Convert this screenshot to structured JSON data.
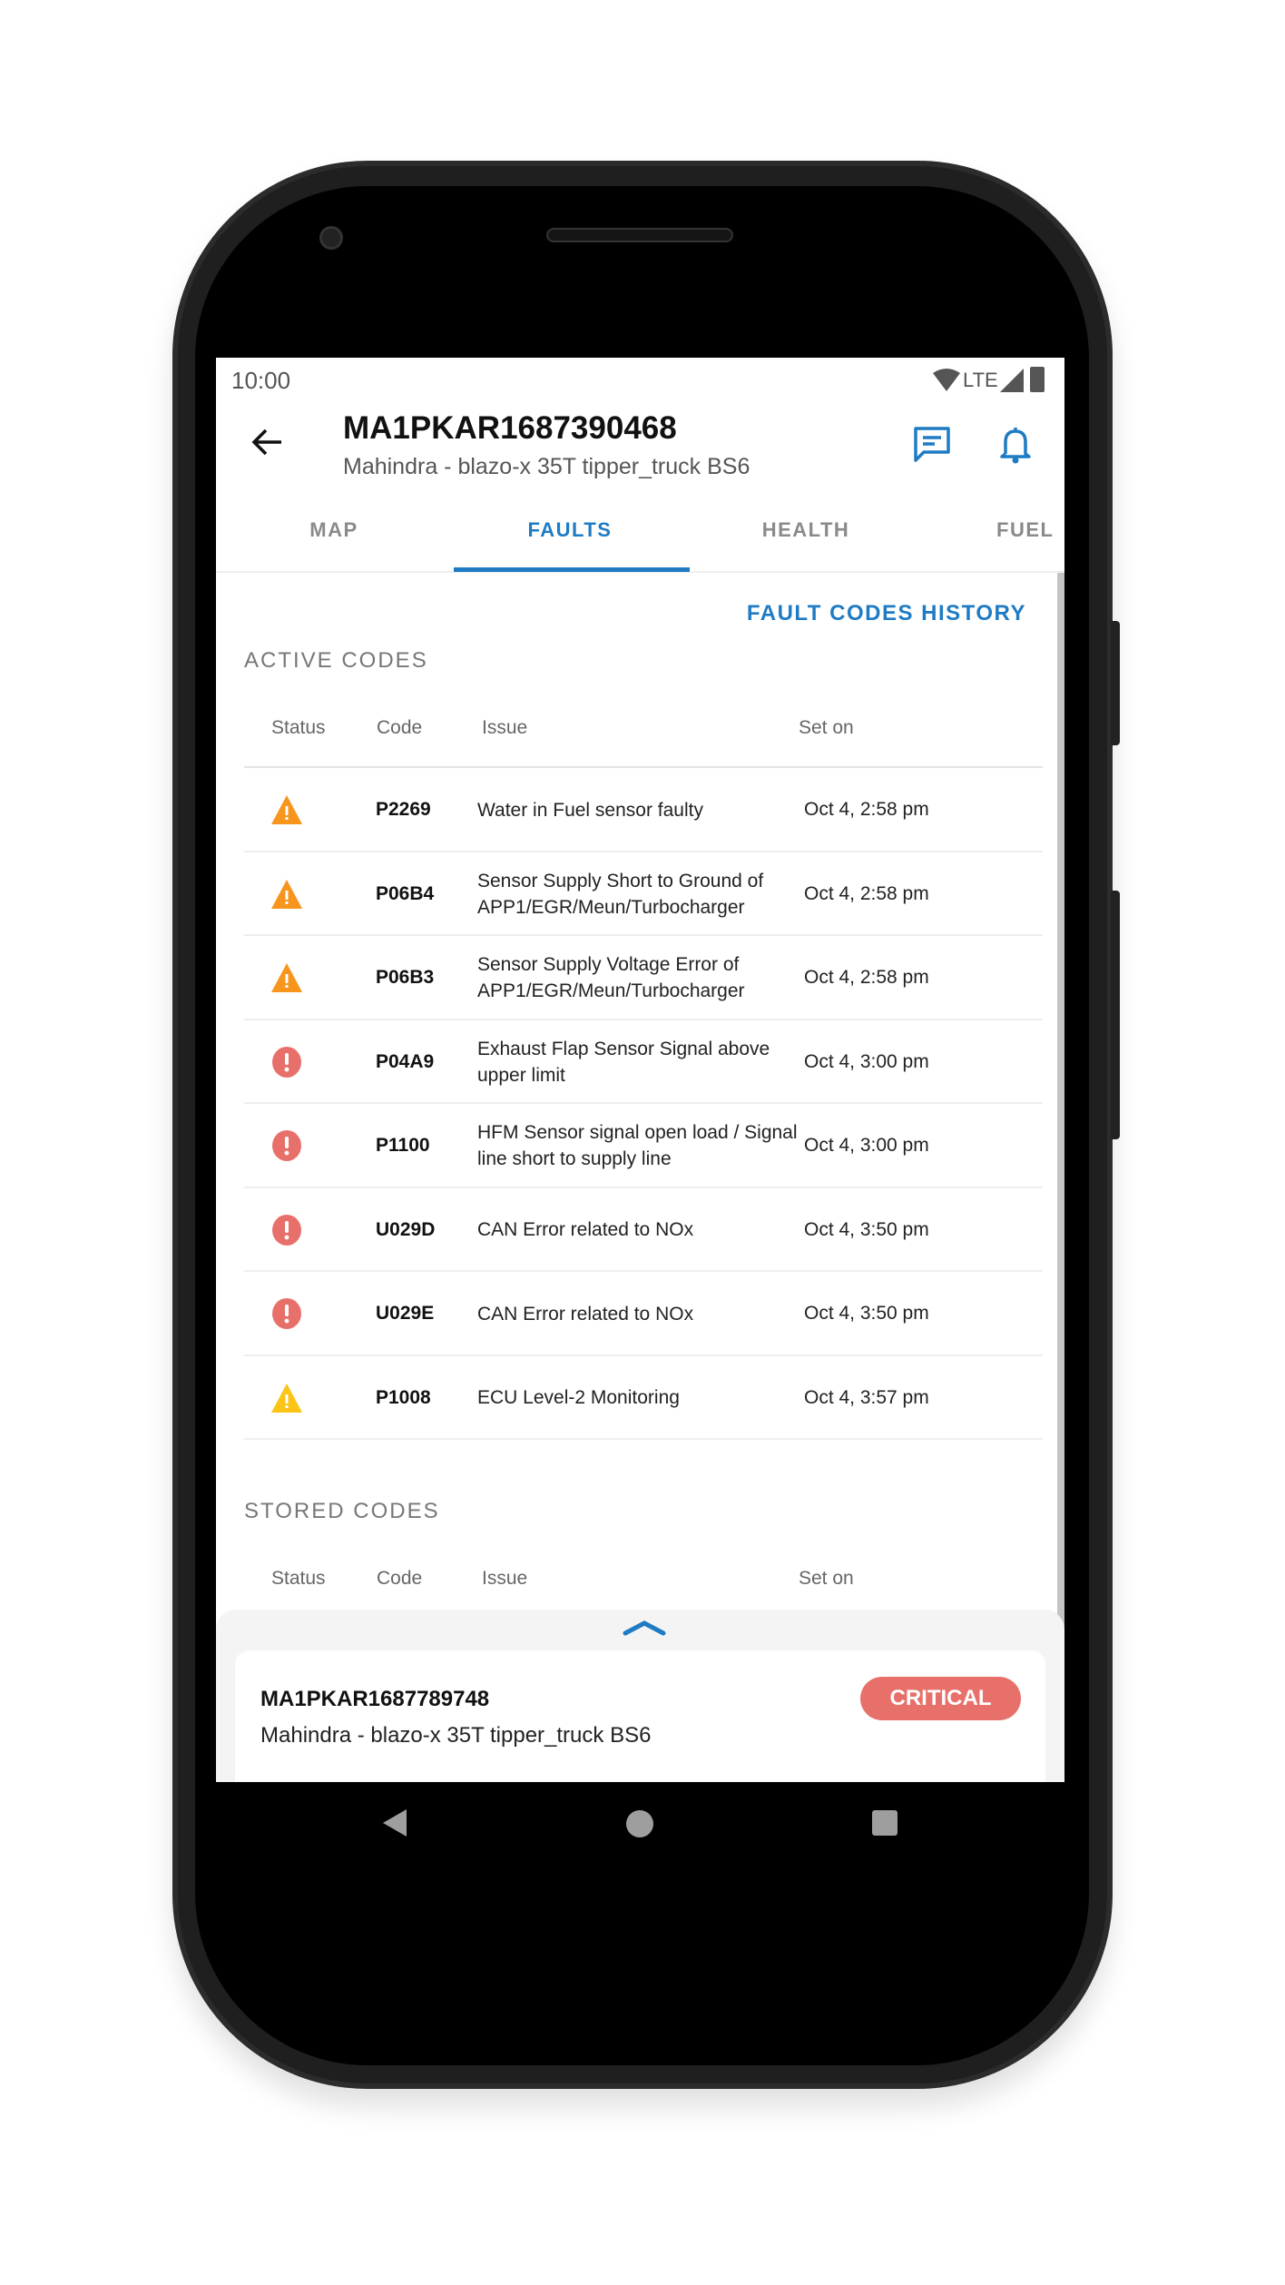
{
  "status_bar": {
    "time": "10:00",
    "network": "LTE",
    "icons": [
      "wifi-icon",
      "signal-icon",
      "battery-icon"
    ]
  },
  "header": {
    "title": "MA1PKAR1687390468",
    "subtitle": "Mahindra - blazo-x 35T tipper_truck BS6",
    "icons": [
      "back-arrow-icon",
      "chat-icon",
      "bell-icon"
    ]
  },
  "tabs": [
    {
      "label": "MAP"
    },
    {
      "label": "FAULTS",
      "active": true
    },
    {
      "label": "HEALTH"
    },
    {
      "label": "FUEL"
    }
  ],
  "history_link": "FAULT CODES HISTORY",
  "active": {
    "title": "ACTIVE CODES",
    "columns": [
      "Status",
      "Code",
      "Issue",
      "Set on"
    ],
    "rows": [
      {
        "status": "warning",
        "code": "P2269",
        "issue": "Water in Fuel sensor faulty",
        "set_on": "Oct 4, 2:58 pm"
      },
      {
        "status": "warning",
        "code": "P06B4",
        "issue": "Sensor Supply  Short to Ground of APP1/EGR/Meun/Turbocharger",
        "set_on": "Oct 4, 2:58 pm"
      },
      {
        "status": "warning",
        "code": "P06B3",
        "issue": "Sensor Supply Voltage Error of APP1/EGR/Meun/Turbocharger",
        "set_on": "Oct 4, 2:58 pm"
      },
      {
        "status": "critical",
        "code": "P04A9",
        "issue": "Exhaust Flap Sensor Signal above upper limit",
        "set_on": "Oct 4, 3:00 pm"
      },
      {
        "status": "critical",
        "code": "P1100",
        "issue": "HFM Sensor signal open load / Signal line short to supply line",
        "set_on": "Oct 4, 3:00 pm"
      },
      {
        "status": "critical",
        "code": "U029D",
        "issue": "CAN Error related to NOx",
        "set_on": "Oct 4, 3:50 pm"
      },
      {
        "status": "critical",
        "code": "U029E",
        "issue": "CAN Error related to NOx",
        "set_on": "Oct 4, 3:50 pm"
      },
      {
        "status": "minor",
        "code": "P1008",
        "issue": "ECU Level-2 Monitoring",
        "set_on": "Oct 4, 3:57 pm"
      }
    ]
  },
  "stored": {
    "title": "STORED CODES",
    "columns": [
      "Status",
      "Code",
      "Issue",
      "Set on"
    ]
  },
  "bottom_sheet": {
    "title": "MA1PKAR1687789748",
    "subtitle": "Mahindra - blazo-x 35T tipper_truck BS6",
    "badge": "CRITICAL"
  },
  "colors": {
    "accent": "#1e7bc4",
    "warning": "#f7951d",
    "minor": "#fbc417",
    "critical": "#e8706a"
  }
}
